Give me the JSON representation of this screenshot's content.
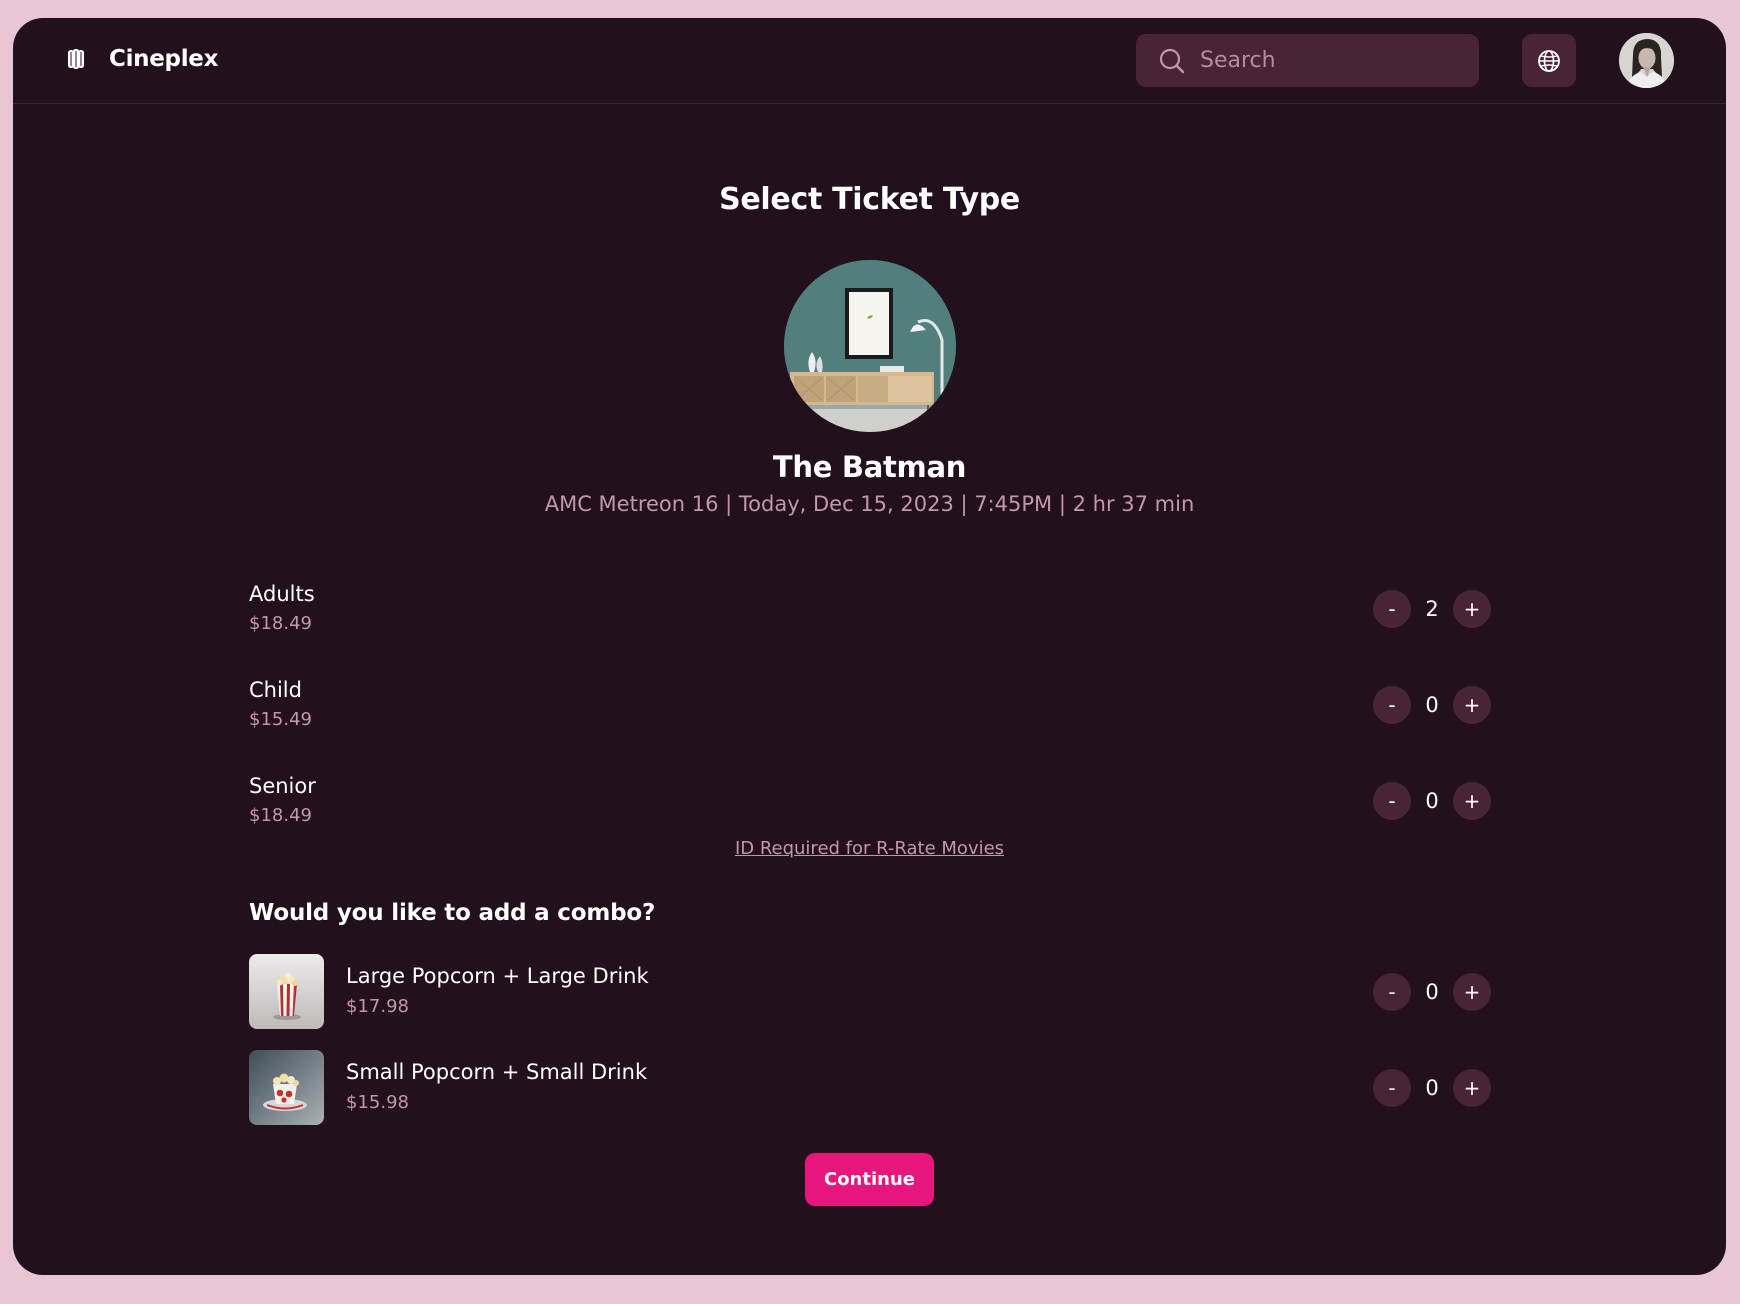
{
  "header": {
    "brand_name": "Cineplex",
    "search_placeholder": "Search",
    "search_value": ""
  },
  "main": {
    "title": "Select Ticket Type",
    "movie": {
      "title": "The Batman",
      "meta": "AMC Metreon 16 | Today, Dec 15, 2023 | 7:45PM | 2 hr 37 min"
    },
    "tickets": [
      {
        "label": "Adults",
        "price": "$18.49",
        "count": "2"
      },
      {
        "label": "Child",
        "price": "$15.49",
        "count": "0"
      },
      {
        "label": "Senior",
        "price": "$18.49",
        "count": "0"
      }
    ],
    "id_notice": "ID Required for R-Rate Movies",
    "combo_heading": "Would you like to add a combo?",
    "combos": [
      {
        "label": "Large Popcorn + Large Drink",
        "price": "$17.98",
        "count": "0"
      },
      {
        "label": "Small Popcorn + Small Drink",
        "price": "$15.98",
        "count": "0"
      }
    ],
    "stepper": {
      "minus": "-",
      "plus": "+"
    },
    "continue_label": "Continue"
  },
  "colors": {
    "background": "#22111c",
    "outer": "#e8c6d6",
    "surface": "#492437",
    "accent": "#e8157c",
    "muted_text": "#c496ad"
  },
  "icons": {
    "brand": "cineplex-logo-icon",
    "search": "search-icon",
    "language": "globe-icon"
  }
}
